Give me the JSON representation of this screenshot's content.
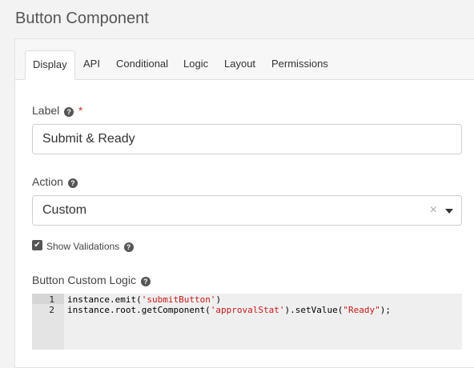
{
  "header": {
    "title": "Button Component"
  },
  "tabs": [
    {
      "label": "Display",
      "active": true
    },
    {
      "label": "API"
    },
    {
      "label": "Conditional"
    },
    {
      "label": "Logic"
    },
    {
      "label": "Layout"
    },
    {
      "label": "Permissions"
    }
  ],
  "label_field": {
    "label": "Label",
    "required_marker": "*",
    "value": "Submit & Ready"
  },
  "action_field": {
    "label": "Action",
    "value": "Custom",
    "clear_glyph": "×"
  },
  "show_validations": {
    "label": "Show Validations",
    "checked": true
  },
  "custom_logic": {
    "label": "Button Custom Logic",
    "lines": [
      {
        "num": "1",
        "parts": [
          {
            "t": "instance.emit("
          },
          {
            "t": "'submitButton'",
            "s": true
          },
          {
            "t": ")"
          }
        ]
      },
      {
        "num": "2",
        "parts": [
          {
            "t": "instance.root.getComponent("
          },
          {
            "t": "'approvalStat'",
            "s": true
          },
          {
            "t": ").setValue("
          },
          {
            "t": "\"Ready\"",
            "s": true
          },
          {
            "t": ");"
          }
        ]
      }
    ]
  },
  "icons": {
    "help": "question-circle-icon",
    "caret": "caret-down-icon",
    "check": "check-icon"
  }
}
